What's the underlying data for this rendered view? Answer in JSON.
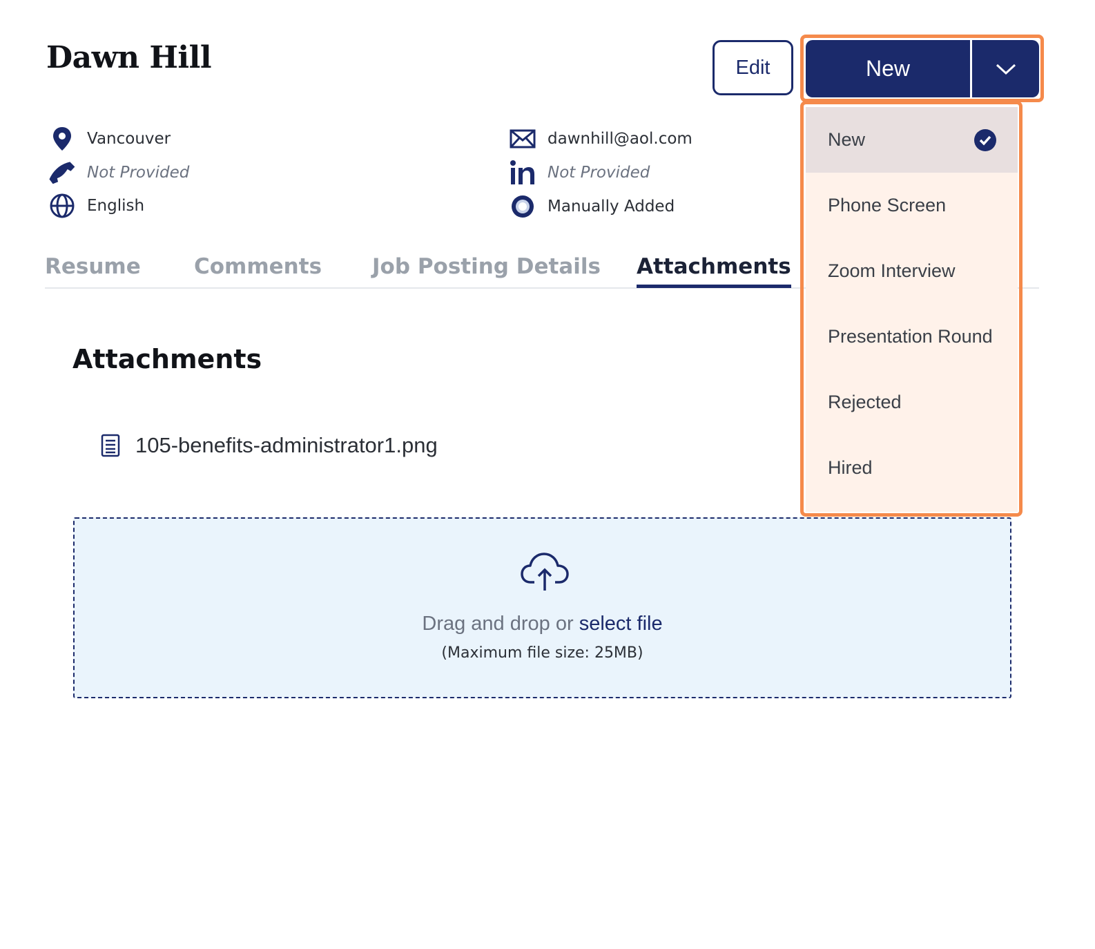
{
  "candidate": {
    "name": "Dawn Hill"
  },
  "actions": {
    "edit_label": "Edit",
    "status_label": "New"
  },
  "details": {
    "location": "Vancouver",
    "phone": "Not Provided",
    "language": "English",
    "email": "dawnhill@aol.com",
    "linkedin": "Not Provided",
    "source": "Manually Added"
  },
  "tabs": [
    {
      "label": "Resume"
    },
    {
      "label": "Comments"
    },
    {
      "label": "Job Posting Details"
    },
    {
      "label": "Attachments",
      "active": true
    }
  ],
  "attachments": {
    "title": "Attachments",
    "files": [
      {
        "name": "105-benefits-administrator1.png"
      }
    ],
    "dropzone": {
      "text_prefix": "Drag and drop or ",
      "link_text": "select file",
      "limit_text": "(Maximum file size: 25MB)"
    }
  },
  "status_menu": {
    "items": [
      {
        "label": "New",
        "selected": true
      },
      {
        "label": "Phone Screen"
      },
      {
        "label": "Zoom Interview"
      },
      {
        "label": "Presentation Round"
      },
      {
        "label": "Rejected"
      },
      {
        "label": "Hired"
      }
    ]
  },
  "colors": {
    "brand": "#1b2a6b",
    "highlight": "#f58a4b",
    "menu_bg": "#fff2ea",
    "dropzone_bg": "#eaf4fc"
  },
  "icons": {
    "location": "map-pin-icon",
    "phone": "phone-icon",
    "language": "globe-icon",
    "email": "envelope-icon",
    "linkedin": "linkedin-icon",
    "source": "radio-source-icon",
    "file": "document-icon",
    "upload": "cloud-upload-icon",
    "selected": "check-circle-icon",
    "caret": "chevron-down-icon"
  }
}
